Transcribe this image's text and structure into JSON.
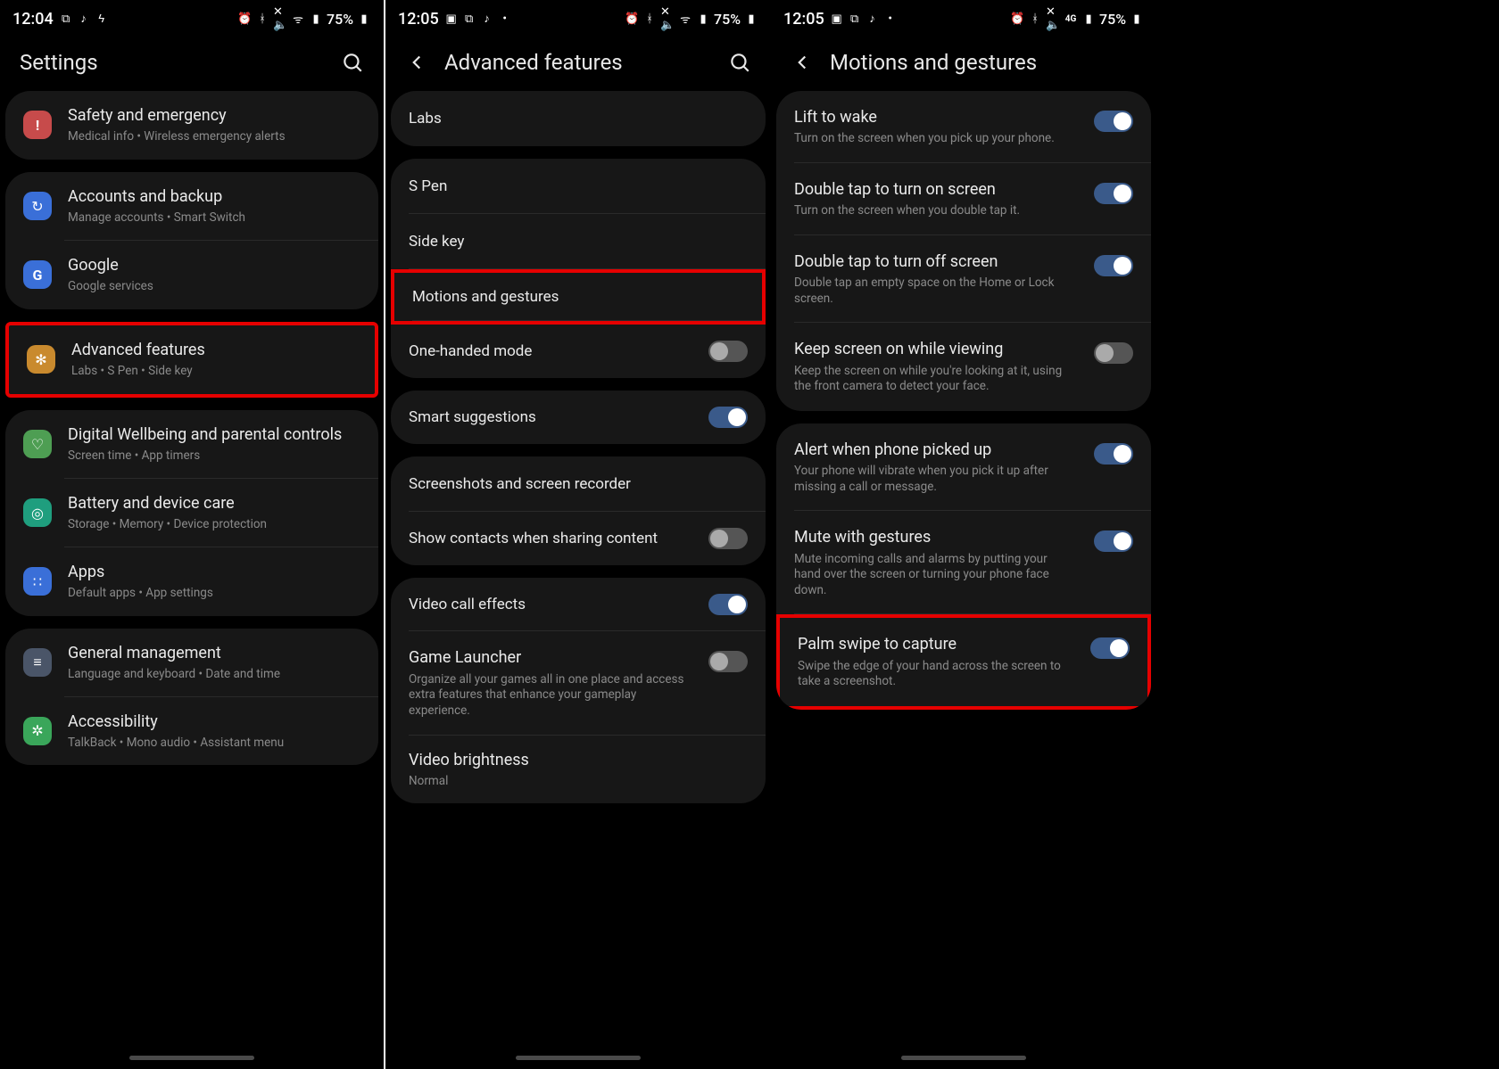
{
  "screens": [
    {
      "status": {
        "time": "12:04",
        "left_icons": [
          "overlay",
          "music",
          "bolt"
        ],
        "right_icons": [
          "alarm",
          "bt",
          "mute",
          "wifi",
          "signal"
        ],
        "battery": "75%"
      },
      "header": {
        "title": "Settings",
        "has_back": false,
        "has_search": true
      },
      "groups": [
        {
          "type": "card",
          "items": [
            {
              "icon": "alert",
              "icon_bg": "bg-red",
              "title": "Safety and emergency",
              "sub": "Medical info  •  Wireless emergency alerts"
            }
          ]
        },
        {
          "type": "card",
          "items": [
            {
              "icon": "sync",
              "icon_bg": "bg-blue1",
              "title": "Accounts and backup",
              "sub": "Manage accounts  •  Smart Switch",
              "sep": true
            },
            {
              "icon": "g",
              "icon_bg": "bg-blue2",
              "title": "Google",
              "sub": "Google services"
            }
          ]
        },
        {
          "type": "card",
          "highlight": true,
          "items": [
            {
              "icon": "gear",
              "icon_bg": "bg-orange",
              "title": "Advanced features",
              "sub": "Labs  •  S Pen  •  Side key"
            }
          ]
        },
        {
          "type": "card",
          "items": [
            {
              "icon": "heart",
              "icon_bg": "bg-green",
              "title": "Digital Wellbeing and parental controls",
              "sub": "Screen time  •  App timers",
              "sep": true
            },
            {
              "icon": "care",
              "icon_bg": "bg-teal",
              "title": "Battery and device care",
              "sub": "Storage  •  Memory  •  Device protection",
              "sep": true
            },
            {
              "icon": "apps",
              "icon_bg": "bg-blue3",
              "title": "Apps",
              "sub": "Default apps  •  App settings"
            }
          ]
        },
        {
          "type": "card",
          "items": [
            {
              "icon": "sliders",
              "icon_bg": "bg-grey",
              "title": "General management",
              "sub": "Language and keyboard  •  Date and time",
              "sep": true
            },
            {
              "icon": "a11y",
              "icon_bg": "bg-green2",
              "title": "Accessibility",
              "sub": "TalkBack  •  Mono audio  •  Assistant menu"
            }
          ]
        }
      ]
    },
    {
      "status": {
        "time": "12:05",
        "left_icons": [
          "image",
          "overlay",
          "music",
          "dot"
        ],
        "right_icons": [
          "alarm",
          "bt",
          "mute",
          "wifi",
          "signal"
        ],
        "battery": "75%"
      },
      "header": {
        "title": "Advanced features",
        "has_back": true,
        "has_search": true
      },
      "groups": [
        {
          "type": "card",
          "items": [
            {
              "title": "Labs"
            }
          ]
        },
        {
          "type": "card",
          "items": [
            {
              "title": "S Pen",
              "sep": true
            },
            {
              "title": "Side key",
              "sep": true
            },
            {
              "title": "Motions and gestures",
              "highlight": true,
              "sep": true
            },
            {
              "title": "One-handed mode",
              "toggle": "off"
            }
          ]
        },
        {
          "type": "card",
          "items": [
            {
              "title": "Smart suggestions",
              "toggle": "on"
            }
          ]
        },
        {
          "type": "card",
          "items": [
            {
              "title": "Screenshots and screen recorder",
              "sep": true
            },
            {
              "title": "Show contacts when sharing content",
              "toggle": "off"
            }
          ]
        },
        {
          "type": "card",
          "items": [
            {
              "title": "Video call effects",
              "toggle": "on",
              "sep": true
            },
            {
              "title": "Game Launcher",
              "sub": "Organize all your games all in one place and access extra features that enhance your gameplay experience.",
              "toggle": "off",
              "sep": true
            },
            {
              "title": "Video brightness",
              "sub": "Normal"
            }
          ]
        }
      ]
    },
    {
      "status": {
        "time": "12:05",
        "left_icons": [
          "image",
          "overlay",
          "music",
          "dot"
        ],
        "right_icons": [
          "alarm",
          "bt",
          "mute",
          "4g",
          "signal"
        ],
        "battery": "75%"
      },
      "header": {
        "title": "Motions and gestures",
        "has_back": true,
        "has_search": false
      },
      "groups": [
        {
          "type": "card",
          "items": [
            {
              "title": "Lift to wake",
              "sub": "Turn on the screen when you pick up your phone.",
              "toggle": "on",
              "sep": true
            },
            {
              "title": "Double tap to turn on screen",
              "sub": "Turn on the screen when you double tap it.",
              "toggle": "on",
              "sep": true
            },
            {
              "title": "Double tap to turn off screen",
              "sub": "Double tap an empty space on the Home or Lock screen.",
              "toggle": "on",
              "sep": true
            },
            {
              "title": "Keep screen on while viewing",
              "sub": "Keep the screen on while you're looking at it, using the front camera to detect your face.",
              "toggle": "off"
            }
          ]
        },
        {
          "type": "card",
          "items": [
            {
              "title": "Alert when phone picked up",
              "sub": "Your phone will vibrate when you pick it up after missing a call or message.",
              "toggle": "on",
              "sep": true
            },
            {
              "title": "Mute with gestures",
              "sub": "Mute incoming calls and alarms by putting your hand over the screen or turning your phone face down.",
              "toggle": "on",
              "sep": true
            },
            {
              "title": "Palm swipe to capture",
              "sub": "Swipe the edge of your hand across the screen to take a screenshot.",
              "toggle": "on",
              "highlight": true
            }
          ]
        }
      ]
    }
  ],
  "icon_glyphs": {
    "alert": "!",
    "sync": "↻",
    "g": "G",
    "gear": "✻",
    "heart": "♡",
    "care": "◎",
    "apps": "∷",
    "sliders": "≡",
    "a11y": "✲",
    "overlay": "⧉",
    "music": "♪",
    "bolt": "⚡",
    "image": "▣",
    "dot": "•",
    "alarm": "⏰",
    "bt": "ᚼ",
    "mute": "🔇",
    "wifi": "ᯤ",
    "signal": "▮",
    "4g": "ᯤG"
  }
}
